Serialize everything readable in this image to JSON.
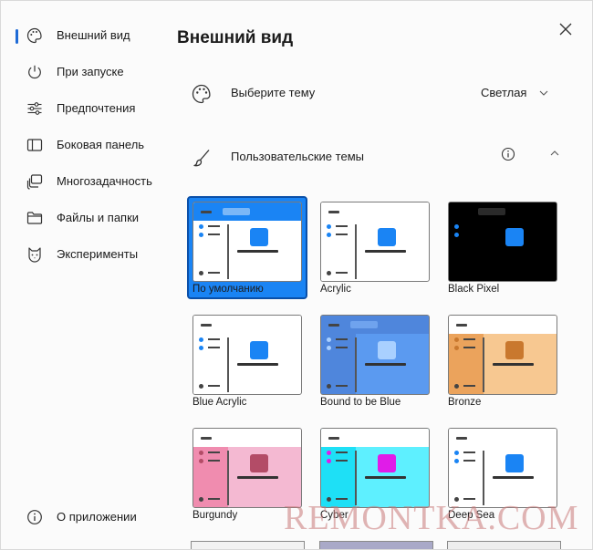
{
  "sidebar": {
    "items": [
      {
        "label": "Внешний вид",
        "icon": "palette-icon",
        "active": true
      },
      {
        "label": "При запуске",
        "icon": "power-icon"
      },
      {
        "label": "Предпочтения",
        "icon": "sliders-icon"
      },
      {
        "label": "Боковая панель",
        "icon": "sidebar-panel-icon"
      },
      {
        "label": "Многозадачность",
        "icon": "multitask-icon"
      },
      {
        "label": "Файлы и папки",
        "icon": "folder-icon"
      },
      {
        "label": "Эксперименты",
        "icon": "cat-icon"
      }
    ],
    "about": {
      "label": "О приложении",
      "icon": "info-icon"
    }
  },
  "main": {
    "title": "Внешний вид",
    "theme_row": {
      "label": "Выберите тему",
      "value": "Светлая"
    },
    "custom_row": {
      "label": "Пользовательские темы"
    },
    "themes": [
      {
        "name": "По умолчанию",
        "selected": true,
        "bg": "#ffffff",
        "top": "#1a84f4",
        "side": "#ffffff",
        "accent": "#1a84f4",
        "pill": "#7bb7f7"
      },
      {
        "name": "Acrylic",
        "bg": "#ffffff",
        "top": "#ffffff",
        "side": "#ffffff",
        "accent": "#1a84f4",
        "pill": ""
      },
      {
        "name": "Black Pixel",
        "bg": "#000000",
        "top": "#000000",
        "side": "#000000",
        "accent": "#1a84f4",
        "pill": "#2a2a2a"
      },
      {
        "name": "Blue Acrylic",
        "bg": "#ffffff",
        "top": "#ffffff",
        "side": "#ffffff",
        "accent": "#1a84f4",
        "pill": ""
      },
      {
        "name": "Bound to be Blue",
        "bg": "#5b9af0",
        "top": "#4f86dc",
        "side": "#4f86dc",
        "accent": "#a9d0ff",
        "pill": "#6fa3ee"
      },
      {
        "name": "Bronze",
        "bg": "#f7c891",
        "top": "#ffffff",
        "side": "#eba35c",
        "accent": "#c9782e",
        "pill": ""
      },
      {
        "name": "Burgundy",
        "bg": "#f4b9d2",
        "top": "#ffffff",
        "side": "#f08caf",
        "accent": "#b34c67",
        "pill": ""
      },
      {
        "name": "Cyber",
        "bg": "#5ef0ff",
        "top": "#ffffff",
        "side": "#1ee0f6",
        "accent": "#e01ce8",
        "pill": ""
      },
      {
        "name": "Deep Sea",
        "bg": "#ffffff",
        "top": "#ffffff",
        "side": "#ffffff",
        "accent": "#1a84f4",
        "pill": ""
      }
    ]
  },
  "watermark": "REMONTKA.COM"
}
